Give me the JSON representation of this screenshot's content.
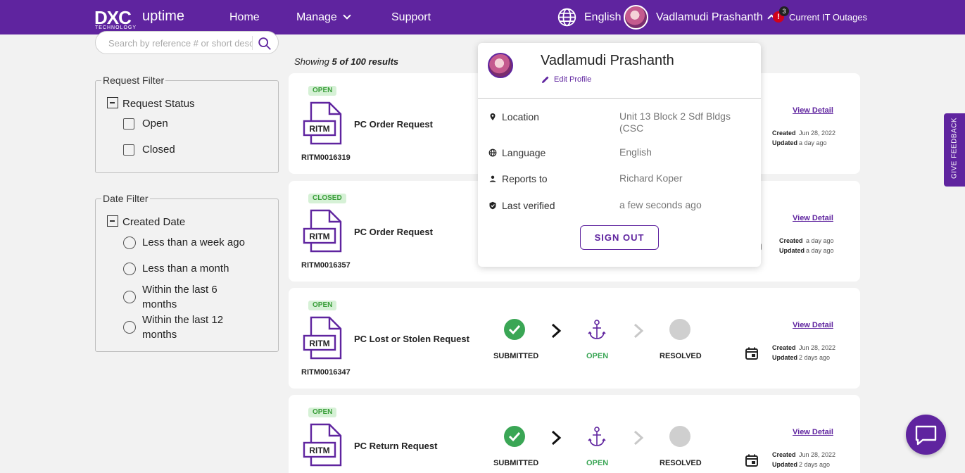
{
  "header": {
    "logo_main": "DXC",
    "logo_sub": "TECHNOLOGY",
    "product": "uptime",
    "nav": {
      "home": "Home",
      "manage": "Manage",
      "support": "Support"
    },
    "language": "English",
    "user_name": "Vadlamudi Prashanth",
    "alert_symbol": "!",
    "alert_count": "3",
    "outages_label": "Current IT Outages"
  },
  "search": {
    "placeholder": "Search by reference # or short description"
  },
  "request_filter": {
    "legend": "Request Filter",
    "heading": "Request Status",
    "options": [
      "Open",
      "Closed"
    ]
  },
  "date_filter": {
    "legend": "Date Filter",
    "heading": "Created Date",
    "options": [
      "Less than a week ago",
      "Less than a month",
      "Within the last 6",
      "months",
      "Within the last 12",
      "months"
    ]
  },
  "results": {
    "prefix": "Showing",
    "count": "5 of 100 results"
  },
  "steps": {
    "submitted": "SUBMITTED",
    "open": "OPEN",
    "resolved": "RESOLVED"
  },
  "doc_icon_label": "RITM",
  "cards": [
    {
      "status": "OPEN",
      "number": "RITM0016319",
      "title": "PC Order Request",
      "view": "View Detail",
      "created_label": "Created",
      "created": "Jun 28, 2022",
      "updated_label": "Updated",
      "updated": "a day ago"
    },
    {
      "status": "CLOSED",
      "number": "RITM0016357",
      "title": "PC Order Request",
      "view": "View Detail",
      "created_label": "Created",
      "created": "a day ago",
      "updated_label": "Updated",
      "updated": "a day ago"
    },
    {
      "status": "OPEN",
      "number": "RITM0016347",
      "title": "PC Lost or Stolen Request",
      "view": "View Detail",
      "created_label": "Created",
      "created": "Jun 28, 2022",
      "updated_label": "Updated",
      "updated": "2 days ago"
    },
    {
      "status": "OPEN",
      "number": "",
      "title": "PC Return Request",
      "view": "View Detail",
      "created_label": "Created",
      "created": "Jun 28, 2022",
      "updated_label": "Updated",
      "updated": "2 days ago"
    }
  ],
  "profile": {
    "name": "Vadlamudi Prashanth",
    "edit": "Edit Profile",
    "rows": [
      {
        "key": "Location",
        "value": "Unit 13 Block 2 Sdf Bldgs (CSC",
        "icon": "location-pin-icon"
      },
      {
        "key": "Language",
        "value": "English",
        "icon": "globe-icon"
      },
      {
        "key": "Reports to",
        "value": "Richard Koper",
        "icon": "person-icon"
      },
      {
        "key": "Last verified",
        "value": "a few seconds ago",
        "icon": "shield-check-icon"
      }
    ],
    "sign_out": "SIGN OUT"
  },
  "feedback": "GIVE FEEDBACK",
  "colors": {
    "brand": "#5f249f",
    "success": "#3aa655",
    "alert": "#d0021b"
  }
}
